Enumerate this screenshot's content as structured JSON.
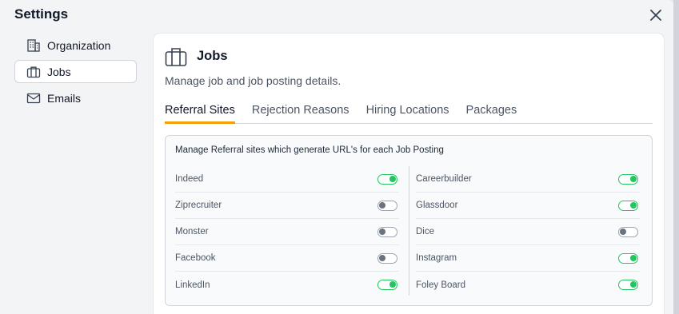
{
  "title": "Settings",
  "sidebar": {
    "items": [
      {
        "label": "Organization",
        "icon": "building-icon",
        "active": false
      },
      {
        "label": "Jobs",
        "icon": "briefcase-icon",
        "active": true
      },
      {
        "label": "Emails",
        "icon": "mail-icon",
        "active": false
      }
    ]
  },
  "panel": {
    "title": "Jobs",
    "subtitle": "Manage job and job posting details.",
    "tabs": [
      {
        "label": "Referral Sites",
        "active": true
      },
      {
        "label": "Rejection Reasons",
        "active": false
      },
      {
        "label": "Hiring Locations",
        "active": false
      },
      {
        "label": "Packages",
        "active": false
      }
    ],
    "card": {
      "description": "Manage Referral sites which generate URL's for each Job Posting",
      "left": [
        {
          "label": "Indeed",
          "enabled": true
        },
        {
          "label": "Ziprecruiter",
          "enabled": false
        },
        {
          "label": "Monster",
          "enabled": false
        },
        {
          "label": "Facebook",
          "enabled": false
        },
        {
          "label": "LinkedIn",
          "enabled": true
        }
      ],
      "right": [
        {
          "label": "Careerbuilder",
          "enabled": true
        },
        {
          "label": "Glassdoor",
          "enabled": true
        },
        {
          "label": "Dice",
          "enabled": false
        },
        {
          "label": "Instagram",
          "enabled": true
        },
        {
          "label": "Foley Board",
          "enabled": true
        }
      ]
    }
  },
  "colors": {
    "accent_tab": "#f59e0b",
    "toggle_on": "#22c55e",
    "toggle_off": "#6b7280"
  }
}
